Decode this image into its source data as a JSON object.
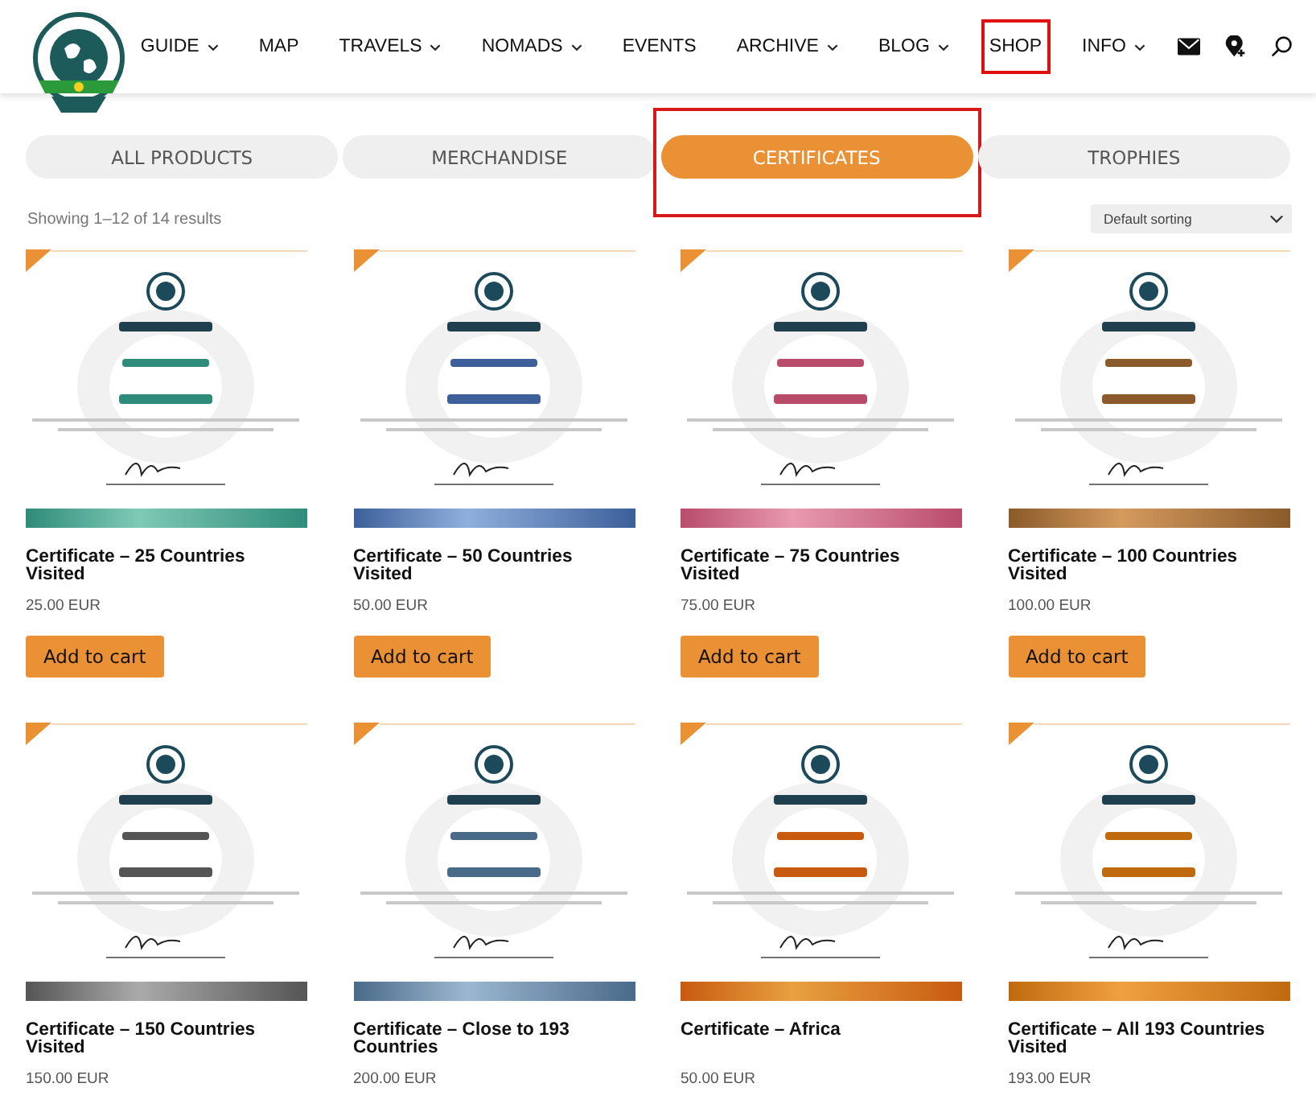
{
  "nav": {
    "items": [
      {
        "label": "GUIDE",
        "dropdown": true,
        "highlighted": false
      },
      {
        "label": "MAP",
        "dropdown": false,
        "highlighted": false
      },
      {
        "label": "TRAVELS",
        "dropdown": true,
        "highlighted": false
      },
      {
        "label": "NOMADS",
        "dropdown": true,
        "highlighted": false
      },
      {
        "label": "EVENTS",
        "dropdown": false,
        "highlighted": false
      },
      {
        "label": "ARCHIVE",
        "dropdown": true,
        "highlighted": false
      },
      {
        "label": "BLOG",
        "dropdown": true,
        "highlighted": false
      },
      {
        "label": "SHOP",
        "dropdown": false,
        "highlighted": true
      },
      {
        "label": "INFO",
        "dropdown": true,
        "highlighted": false
      }
    ]
  },
  "tabs": [
    {
      "label": "ALL PRODUCTS",
      "selected": false
    },
    {
      "label": "MERCHANDISE",
      "selected": false
    },
    {
      "label": "CERTIFICATES",
      "selected": true
    },
    {
      "label": "TROPHIES",
      "selected": false
    }
  ],
  "result_count": "Showing 1–12 of 14 results",
  "sorting": {
    "value": "Default sorting"
  },
  "products": [
    {
      "title": "Certificate – 25 Countries Visited",
      "price": "25.00 EUR",
      "button": "Add to cart"
    },
    {
      "title": "Certificate – 50 Countries Visited",
      "price": "50.00 EUR",
      "button": "Add to cart"
    },
    {
      "title": "Certificate – 75 Countries Visited",
      "price": "75.00 EUR",
      "button": "Add to cart"
    },
    {
      "title": "Certificate – 100 Countries Visited",
      "price": "100.00 EUR",
      "button": "Add to cart"
    },
    {
      "title": "Certificate – 150 Countries Visited",
      "price": "150.00 EUR"
    },
    {
      "title": "Certificate – Close to 193 Countries",
      "price": "200.00 EUR"
    },
    {
      "title": "Certificate – Africa",
      "price": "50.00 EUR"
    },
    {
      "title": "Certificate – All 193 Countries Visited",
      "price": "193.00 EUR"
    }
  ]
}
